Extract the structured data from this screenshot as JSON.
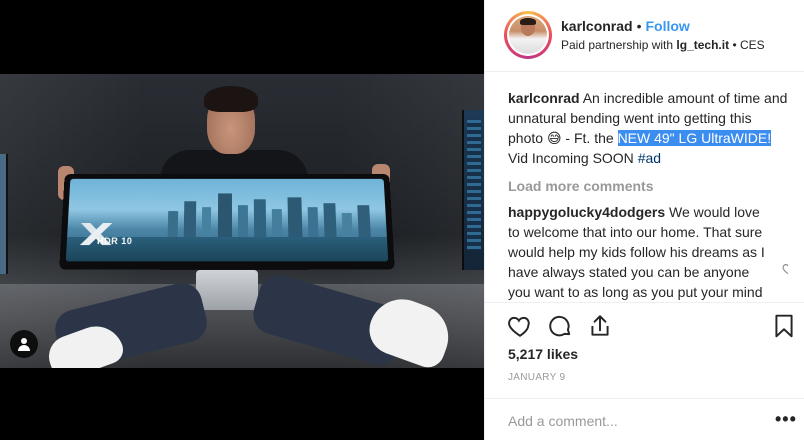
{
  "post": {
    "author": "karlconrad",
    "follow_label": "Follow",
    "dot": "•",
    "partnership_prefix": "Paid partnership with",
    "partner": "lg_tech.it",
    "location": "CES",
    "location_sep": "•"
  },
  "image": {
    "screen_badge": "HDR 10"
  },
  "caption": {
    "user": "karlconrad",
    "text_1": "An incredible amount of time and unnatural bending went into getting this photo",
    "emoji": "😅",
    "text_2": " - Ft. the ",
    "highlight": "NEW 49\" LG UltraWIDE!",
    "text_3": " Vid Incoming SOON ",
    "hashtag": "#ad"
  },
  "load_more_label": "Load more comments",
  "comments": [
    {
      "user": "happygolucky4dodgers",
      "text": "We would love to welcome that into our home. That sure would help my kids follow his dreams as I have always stated you can be anyone you want to as long as you put your mind to it. Also follow"
    }
  ],
  "engagement": {
    "likes": "5,217 likes",
    "date": "JANUARY 9"
  },
  "comment_box": {
    "placeholder": "Add a comment...",
    "more": "•••"
  },
  "icons": {
    "like": "heart-icon",
    "comment": "comment-icon",
    "share": "share-icon",
    "save": "bookmark-icon",
    "tag": "user-tag-icon",
    "comment_like": "heart-icon"
  }
}
